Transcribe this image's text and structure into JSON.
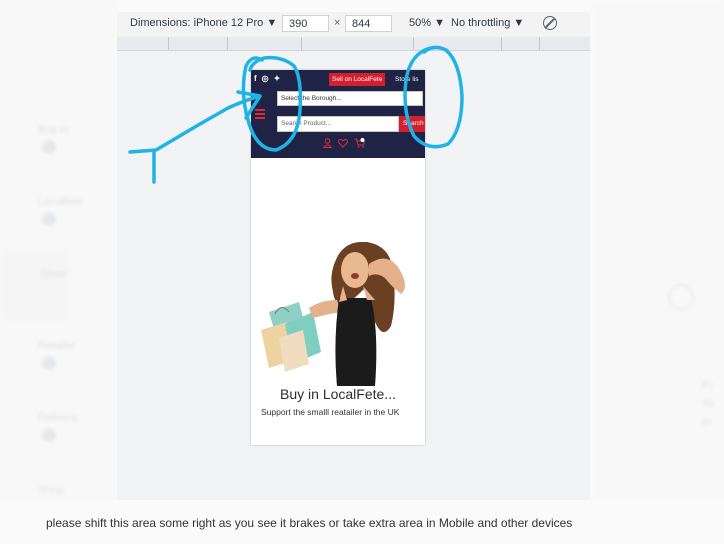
{
  "devtools": {
    "dimensions_label": "Dimensions: iPhone 12 Pro ▼",
    "width": "390",
    "times": "×",
    "height": "844",
    "zoom": "50% ▼",
    "throttling": "No throttling ▼"
  },
  "site": {
    "sell_label": "Sell on LocalFete",
    "store_label": "Store lis",
    "borough_placeholder": "Select the Borough...",
    "search_placeholder": "Search Product...",
    "search_button": "Search",
    "hero_title": "Buy in LocalFete...",
    "hero_subtitle": "Support the smalll reatailer in the UK"
  },
  "annotation_color": "#1fb3e6",
  "accent_red": "#d4202e",
  "header_navy": "#1f2447",
  "caption": "please shift this area some right as you see it brakes or take extra area in Mobile and other devices"
}
